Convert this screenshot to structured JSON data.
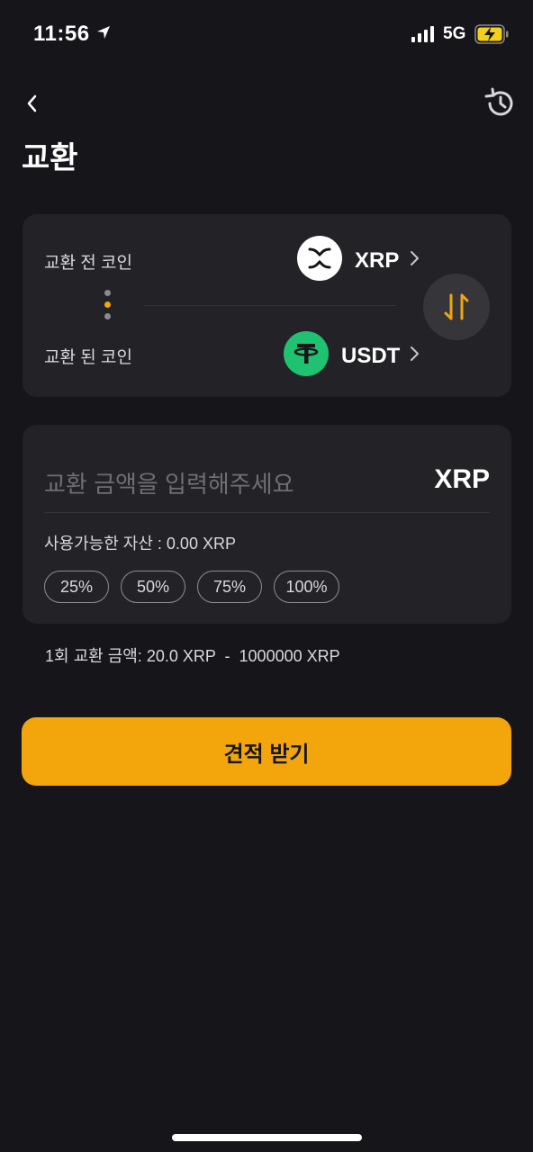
{
  "status_bar": {
    "time": "11:56",
    "network": "5G",
    "icons": [
      "location-arrow-icon",
      "signal-icon",
      "battery-charging-icon"
    ]
  },
  "header": {
    "title": "교환",
    "icons": [
      "chevron-left-icon",
      "history-icon"
    ]
  },
  "pair": {
    "from_label": "교환 전 코인",
    "from_coin": "XRP",
    "to_label": "교환 된 코인",
    "to_coin": "USDT",
    "swap_icon": "swap-arrows-icon"
  },
  "amount": {
    "placeholder": "교환 금액을 입력해주세요",
    "unit": "XRP",
    "available": "사용가능한 자산 : 0.00 XRP",
    "percent_options": [
      "25%",
      "50%",
      "75%",
      "100%"
    ]
  },
  "limit": "1회 교환 금액: 20.0 XRP  -  1000000 XRP",
  "submit_label": "견적 받기",
  "colors": {
    "background": "#16161a",
    "card": "#232327",
    "accent": "#f3a50c",
    "usdt_green": "#1fc270"
  }
}
